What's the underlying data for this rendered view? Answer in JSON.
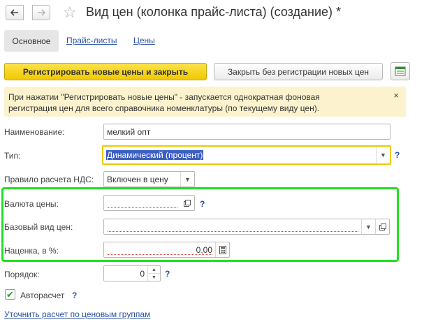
{
  "window": {
    "title": "Вид цен (колонка прайс-листа) (создание) *"
  },
  "tabs": [
    {
      "label": "Основное"
    },
    {
      "label": "Прайс-листы"
    },
    {
      "label": "Цены"
    }
  ],
  "toolbar": {
    "register_close_label": "Регистрировать новые цены и закрыть",
    "close_no_register_label": "Закрыть без регистрации новых цен"
  },
  "info": {
    "line1": "При нажатии \"Регистрировать новые цены\" - запускается однократная фоновая",
    "line2": "регистрация цен для всего справочника номенклатуры (по текущему виду цен).",
    "close_glyph": "×"
  },
  "form": {
    "name": {
      "label": "Наименование:",
      "value": "мелкий опт"
    },
    "type": {
      "label": "Тип:",
      "value": "Динамический (процент)"
    },
    "vat": {
      "label": "Правило расчета НДС:",
      "value": "Включен в цену"
    },
    "currency": {
      "label": "Валюта цены:",
      "value": ""
    },
    "base_price": {
      "label": "Базовый вид цен:",
      "value": ""
    },
    "markup": {
      "label": "Наценка, в %:",
      "value": "0,00"
    },
    "order": {
      "label": "Порядок:",
      "value": "0"
    },
    "auto_calc": {
      "label": "Авторасчет",
      "checked": true
    },
    "help_glyph": "?"
  },
  "links": {
    "refine_calc": "Уточнить расчет по ценовым группам"
  },
  "colors": {
    "accent_yellow": "#f5d20e",
    "link_blue": "#2b52a4",
    "highlight_green": "#22e022",
    "info_bg": "#fcf3ce"
  }
}
